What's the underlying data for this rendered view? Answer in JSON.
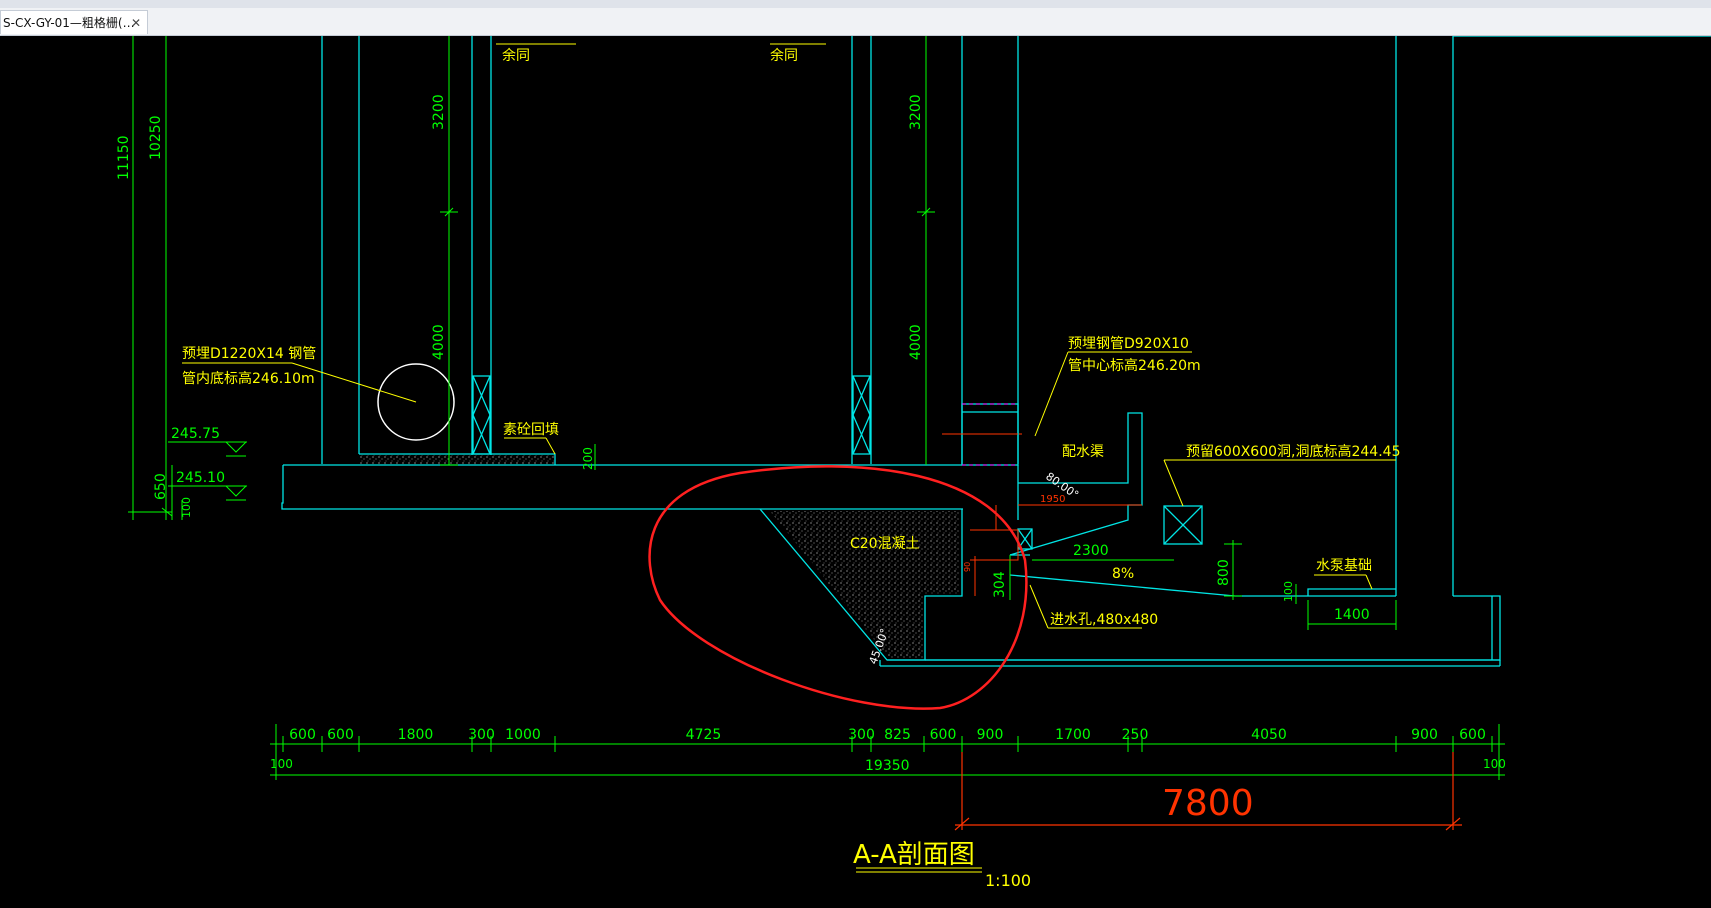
{
  "tab": {
    "title": "S-CX-GY-01—粗格栅(…",
    "close_symbol": "✕"
  },
  "colors": {
    "green": "#00ff00",
    "cyan": "#00e5e5",
    "yellow": "#ffff00",
    "red": "#ff2020",
    "orange": "#ff3300",
    "white": "#ffffff",
    "magenta": "#ff00ff"
  },
  "drawing": {
    "title": "A-A剖面图",
    "scale": "1:100",
    "big_dim": "7800",
    "vdims": {
      "d11150": "11150",
      "d10250": "10250",
      "d3200a": "3200",
      "d4000a": "4000",
      "d3200b": "3200",
      "d4000b": "4000",
      "d650": "650",
      "d100": "100",
      "d200": "200",
      "d800": "800",
      "d304": "304",
      "d100b": "100"
    },
    "notes": {
      "pipe_left_1": "预埋D1220X14 钢管",
      "pipe_left_2": "管内底标高246.10m",
      "pipe_right_1": "预埋钢管D920X10",
      "pipe_right_2": "管中心标高246.20m",
      "top_left_cut": "余同",
      "top_right_cut": "余同",
      "backfill": "素砼回填",
      "channel": "配水渠",
      "opening": "预留600X600洞,洞底标高244.45",
      "concrete": "C20混凝土",
      "pump_base": "水泵基础",
      "inlet_hole": "进水孔,480x480",
      "slope": "8%",
      "angle_80": "80.00°",
      "angle_45": "45.00°",
      "d1950": "1950",
      "d2300": "2300",
      "d1400": "1400",
      "small_red": "90"
    },
    "elevations": {
      "e1": "245.75",
      "e2": "245.10"
    },
    "bottom_dims": [
      "600",
      "600",
      "1800",
      "300",
      "1000",
      "4725",
      "300",
      "825",
      "600",
      "900",
      "1700",
      "250",
      "4050",
      "900",
      "600"
    ],
    "total_dim": "19350",
    "edge_left": "100",
    "edge_right": "100"
  }
}
